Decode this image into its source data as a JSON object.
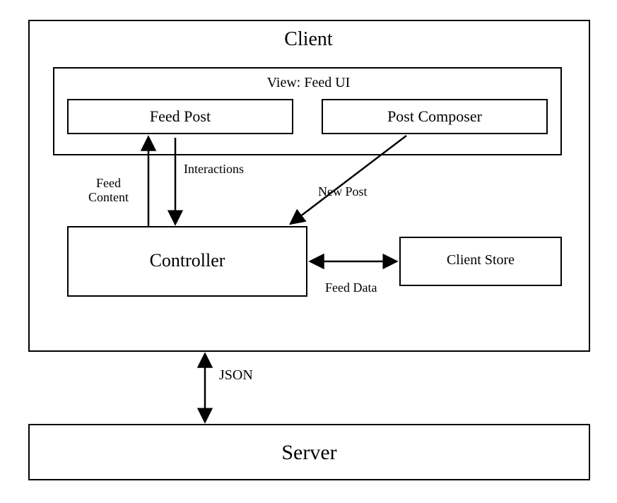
{
  "boxes": {
    "client": "Client",
    "view": "View: Feed UI",
    "feed_post": "Feed Post",
    "post_composer": "Post Composer",
    "controller": "Controller",
    "client_store": "Client Store",
    "server": "Server"
  },
  "labels": {
    "interactions": "Interactions",
    "feed_content_line1": "Feed",
    "feed_content_line2": "Content",
    "new_post": "New Post",
    "feed_data": "Feed Data",
    "json": "JSON"
  }
}
